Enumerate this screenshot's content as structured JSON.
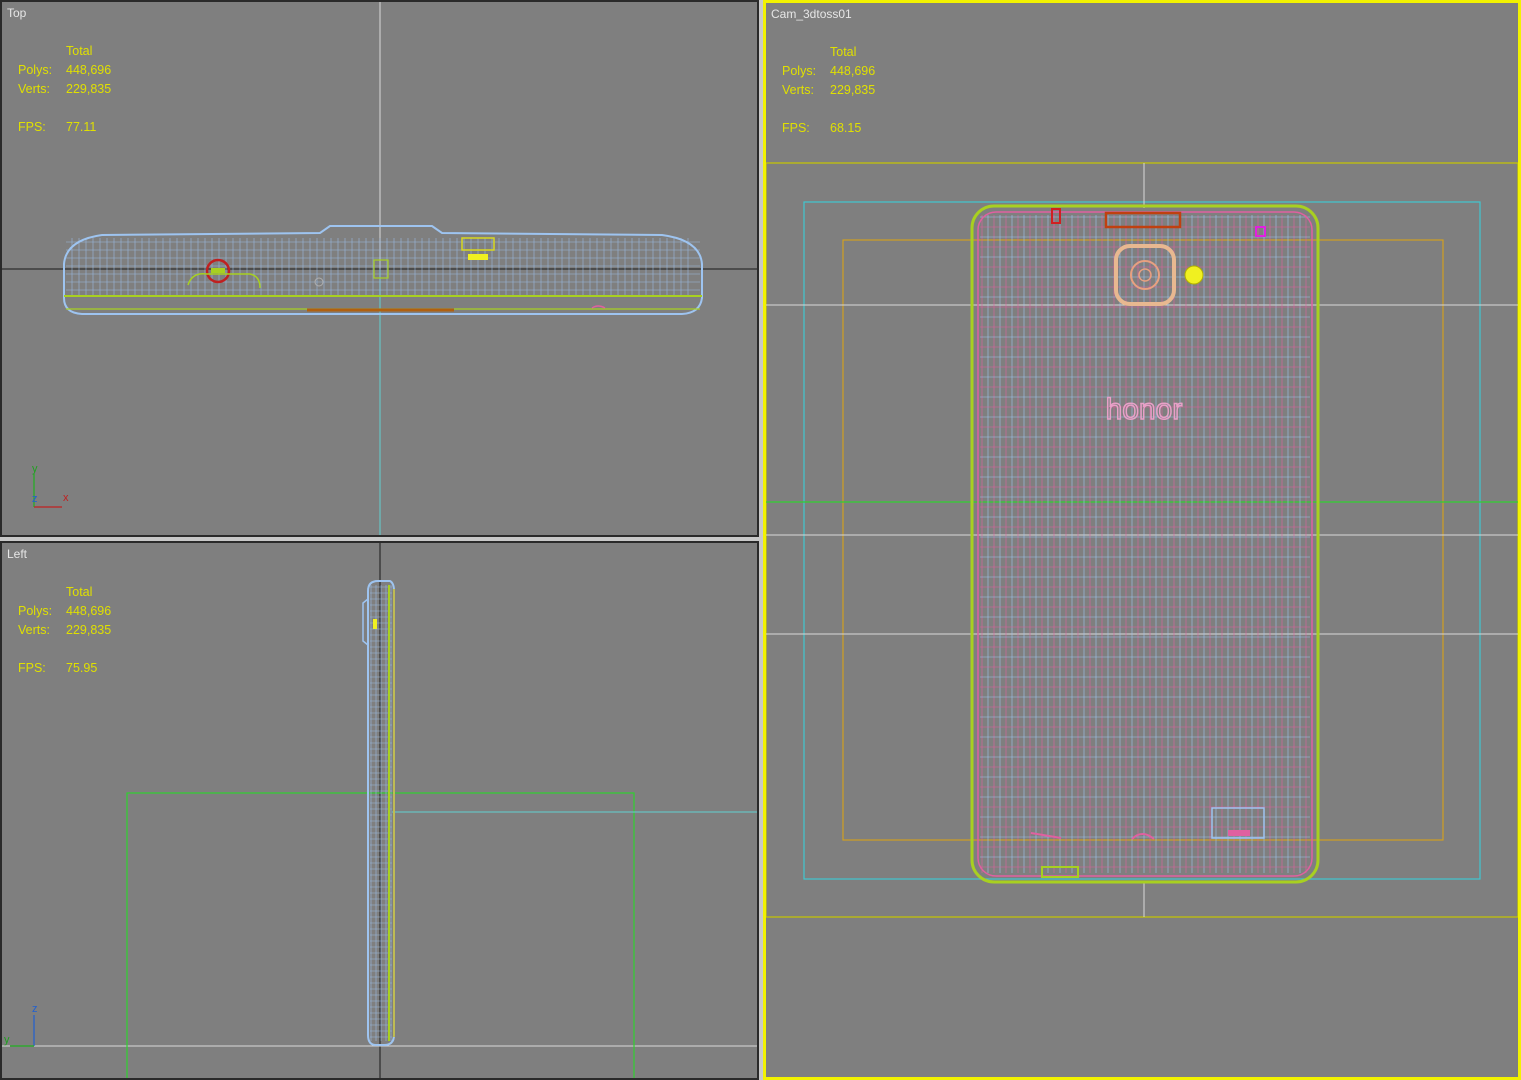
{
  "viewports": {
    "top": {
      "label": "Top",
      "total": "Total",
      "polys_label": "Polys:",
      "polys": "448,696",
      "verts_label": "Verts:",
      "verts": "229,835",
      "fps_label": "FPS:",
      "fps": "77.11"
    },
    "left": {
      "label": "Left",
      "total": "Total",
      "polys_label": "Polys:",
      "polys": "448,696",
      "verts_label": "Verts:",
      "verts": "229,835",
      "fps_label": "FPS:",
      "fps": "75.95"
    },
    "camera": {
      "label": "Cam_3dtoss01",
      "total": "Total",
      "polys_label": "Polys:",
      "polys": "448,696",
      "verts_label": "Verts:",
      "verts": "229,835",
      "fps_label": "FPS:",
      "fps": "68.15"
    }
  },
  "axes": {
    "top": {
      "up": "y",
      "center": "z",
      "right": "x"
    },
    "left": {
      "up": "z",
      "right": "y"
    }
  },
  "model": {
    "brand_text": "honor"
  },
  "colors": {
    "viewport_bg": "#7f7f7f",
    "active_border": "#f2f200",
    "stats_text": "#e0e000",
    "wire_blue": "#9ec4f0",
    "wire_pink": "#e060a0",
    "wire_green": "#a8d020",
    "safe_frame_yellow": "#c8c800",
    "safe_frame_cyan": "#40c8d0",
    "safe_frame_orange": "#d0a020"
  }
}
